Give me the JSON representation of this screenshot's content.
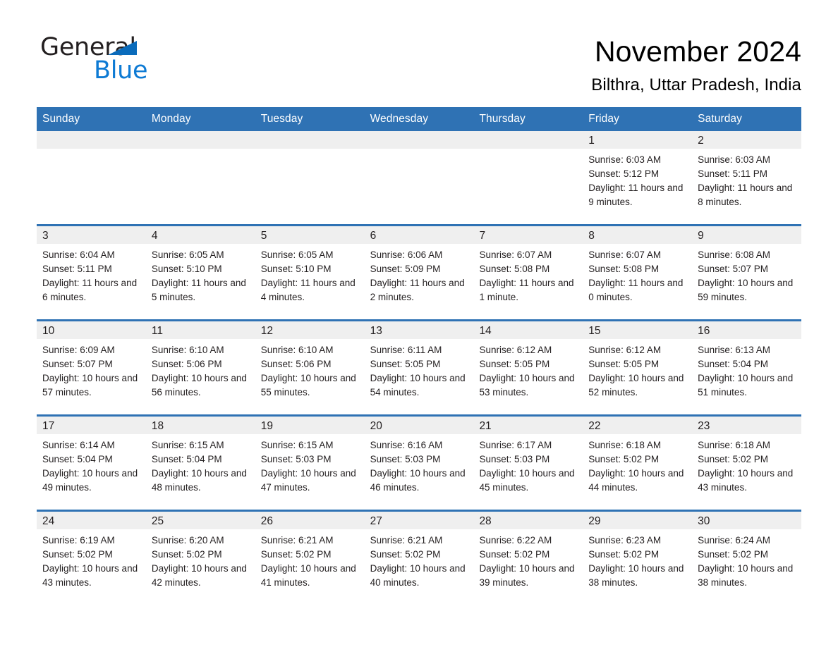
{
  "brand": {
    "name_part1": "General",
    "name_part2": "Blue",
    "triangle_color": "#0a6bbb",
    "blue_color": "#0d7ad4"
  },
  "header": {
    "month_title": "November 2024",
    "location": "Bilthra, Uttar Pradesh, India"
  },
  "theme": {
    "header_blue": "#2f72b4",
    "date_band_gray": "#efefef",
    "text_color": "#231f20"
  },
  "weekdays": [
    "Sunday",
    "Monday",
    "Tuesday",
    "Wednesday",
    "Thursday",
    "Friday",
    "Saturday"
  ],
  "weeks": [
    [
      {
        "day": "",
        "sunrise": "",
        "sunset": "",
        "daylight": "",
        "empty": true
      },
      {
        "day": "",
        "sunrise": "",
        "sunset": "",
        "daylight": "",
        "empty": true
      },
      {
        "day": "",
        "sunrise": "",
        "sunset": "",
        "daylight": "",
        "empty": true
      },
      {
        "day": "",
        "sunrise": "",
        "sunset": "",
        "daylight": "",
        "empty": true
      },
      {
        "day": "",
        "sunrise": "",
        "sunset": "",
        "daylight": "",
        "empty": true
      },
      {
        "day": "1",
        "sunrise": "Sunrise: 6:03 AM",
        "sunset": "Sunset: 5:12 PM",
        "daylight": "Daylight: 11 hours and 9 minutes.",
        "empty": false
      },
      {
        "day": "2",
        "sunrise": "Sunrise: 6:03 AM",
        "sunset": "Sunset: 5:11 PM",
        "daylight": "Daylight: 11 hours and 8 minutes.",
        "empty": false
      }
    ],
    [
      {
        "day": "3",
        "sunrise": "Sunrise: 6:04 AM",
        "sunset": "Sunset: 5:11 PM",
        "daylight": "Daylight: 11 hours and 6 minutes.",
        "empty": false
      },
      {
        "day": "4",
        "sunrise": "Sunrise: 6:05 AM",
        "sunset": "Sunset: 5:10 PM",
        "daylight": "Daylight: 11 hours and 5 minutes.",
        "empty": false
      },
      {
        "day": "5",
        "sunrise": "Sunrise: 6:05 AM",
        "sunset": "Sunset: 5:10 PM",
        "daylight": "Daylight: 11 hours and 4 minutes.",
        "empty": false
      },
      {
        "day": "6",
        "sunrise": "Sunrise: 6:06 AM",
        "sunset": "Sunset: 5:09 PM",
        "daylight": "Daylight: 11 hours and 2 minutes.",
        "empty": false
      },
      {
        "day": "7",
        "sunrise": "Sunrise: 6:07 AM",
        "sunset": "Sunset: 5:08 PM",
        "daylight": "Daylight: 11 hours and 1 minute.",
        "empty": false
      },
      {
        "day": "8",
        "sunrise": "Sunrise: 6:07 AM",
        "sunset": "Sunset: 5:08 PM",
        "daylight": "Daylight: 11 hours and 0 minutes.",
        "empty": false
      },
      {
        "day": "9",
        "sunrise": "Sunrise: 6:08 AM",
        "sunset": "Sunset: 5:07 PM",
        "daylight": "Daylight: 10 hours and 59 minutes.",
        "empty": false
      }
    ],
    [
      {
        "day": "10",
        "sunrise": "Sunrise: 6:09 AM",
        "sunset": "Sunset: 5:07 PM",
        "daylight": "Daylight: 10 hours and 57 minutes.",
        "empty": false
      },
      {
        "day": "11",
        "sunrise": "Sunrise: 6:10 AM",
        "sunset": "Sunset: 5:06 PM",
        "daylight": "Daylight: 10 hours and 56 minutes.",
        "empty": false
      },
      {
        "day": "12",
        "sunrise": "Sunrise: 6:10 AM",
        "sunset": "Sunset: 5:06 PM",
        "daylight": "Daylight: 10 hours and 55 minutes.",
        "empty": false
      },
      {
        "day": "13",
        "sunrise": "Sunrise: 6:11 AM",
        "sunset": "Sunset: 5:05 PM",
        "daylight": "Daylight: 10 hours and 54 minutes.",
        "empty": false
      },
      {
        "day": "14",
        "sunrise": "Sunrise: 6:12 AM",
        "sunset": "Sunset: 5:05 PM",
        "daylight": "Daylight: 10 hours and 53 minutes.",
        "empty": false
      },
      {
        "day": "15",
        "sunrise": "Sunrise: 6:12 AM",
        "sunset": "Sunset: 5:05 PM",
        "daylight": "Daylight: 10 hours and 52 minutes.",
        "empty": false
      },
      {
        "day": "16",
        "sunrise": "Sunrise: 6:13 AM",
        "sunset": "Sunset: 5:04 PM",
        "daylight": "Daylight: 10 hours and 51 minutes.",
        "empty": false
      }
    ],
    [
      {
        "day": "17",
        "sunrise": "Sunrise: 6:14 AM",
        "sunset": "Sunset: 5:04 PM",
        "daylight": "Daylight: 10 hours and 49 minutes.",
        "empty": false
      },
      {
        "day": "18",
        "sunrise": "Sunrise: 6:15 AM",
        "sunset": "Sunset: 5:04 PM",
        "daylight": "Daylight: 10 hours and 48 minutes.",
        "empty": false
      },
      {
        "day": "19",
        "sunrise": "Sunrise: 6:15 AM",
        "sunset": "Sunset: 5:03 PM",
        "daylight": "Daylight: 10 hours and 47 minutes.",
        "empty": false
      },
      {
        "day": "20",
        "sunrise": "Sunrise: 6:16 AM",
        "sunset": "Sunset: 5:03 PM",
        "daylight": "Daylight: 10 hours and 46 minutes.",
        "empty": false
      },
      {
        "day": "21",
        "sunrise": "Sunrise: 6:17 AM",
        "sunset": "Sunset: 5:03 PM",
        "daylight": "Daylight: 10 hours and 45 minutes.",
        "empty": false
      },
      {
        "day": "22",
        "sunrise": "Sunrise: 6:18 AM",
        "sunset": "Sunset: 5:02 PM",
        "daylight": "Daylight: 10 hours and 44 minutes.",
        "empty": false
      },
      {
        "day": "23",
        "sunrise": "Sunrise: 6:18 AM",
        "sunset": "Sunset: 5:02 PM",
        "daylight": "Daylight: 10 hours and 43 minutes.",
        "empty": false
      }
    ],
    [
      {
        "day": "24",
        "sunrise": "Sunrise: 6:19 AM",
        "sunset": "Sunset: 5:02 PM",
        "daylight": "Daylight: 10 hours and 43 minutes.",
        "empty": false
      },
      {
        "day": "25",
        "sunrise": "Sunrise: 6:20 AM",
        "sunset": "Sunset: 5:02 PM",
        "daylight": "Daylight: 10 hours and 42 minutes.",
        "empty": false
      },
      {
        "day": "26",
        "sunrise": "Sunrise: 6:21 AM",
        "sunset": "Sunset: 5:02 PM",
        "daylight": "Daylight: 10 hours and 41 minutes.",
        "empty": false
      },
      {
        "day": "27",
        "sunrise": "Sunrise: 6:21 AM",
        "sunset": "Sunset: 5:02 PM",
        "daylight": "Daylight: 10 hours and 40 minutes.",
        "empty": false
      },
      {
        "day": "28",
        "sunrise": "Sunrise: 6:22 AM",
        "sunset": "Sunset: 5:02 PM",
        "daylight": "Daylight: 10 hours and 39 minutes.",
        "empty": false
      },
      {
        "day": "29",
        "sunrise": "Sunrise: 6:23 AM",
        "sunset": "Sunset: 5:02 PM",
        "daylight": "Daylight: 10 hours and 38 minutes.",
        "empty": false
      },
      {
        "day": "30",
        "sunrise": "Sunrise: 6:24 AM",
        "sunset": "Sunset: 5:02 PM",
        "daylight": "Daylight: 10 hours and 38 minutes.",
        "empty": false
      }
    ]
  ]
}
